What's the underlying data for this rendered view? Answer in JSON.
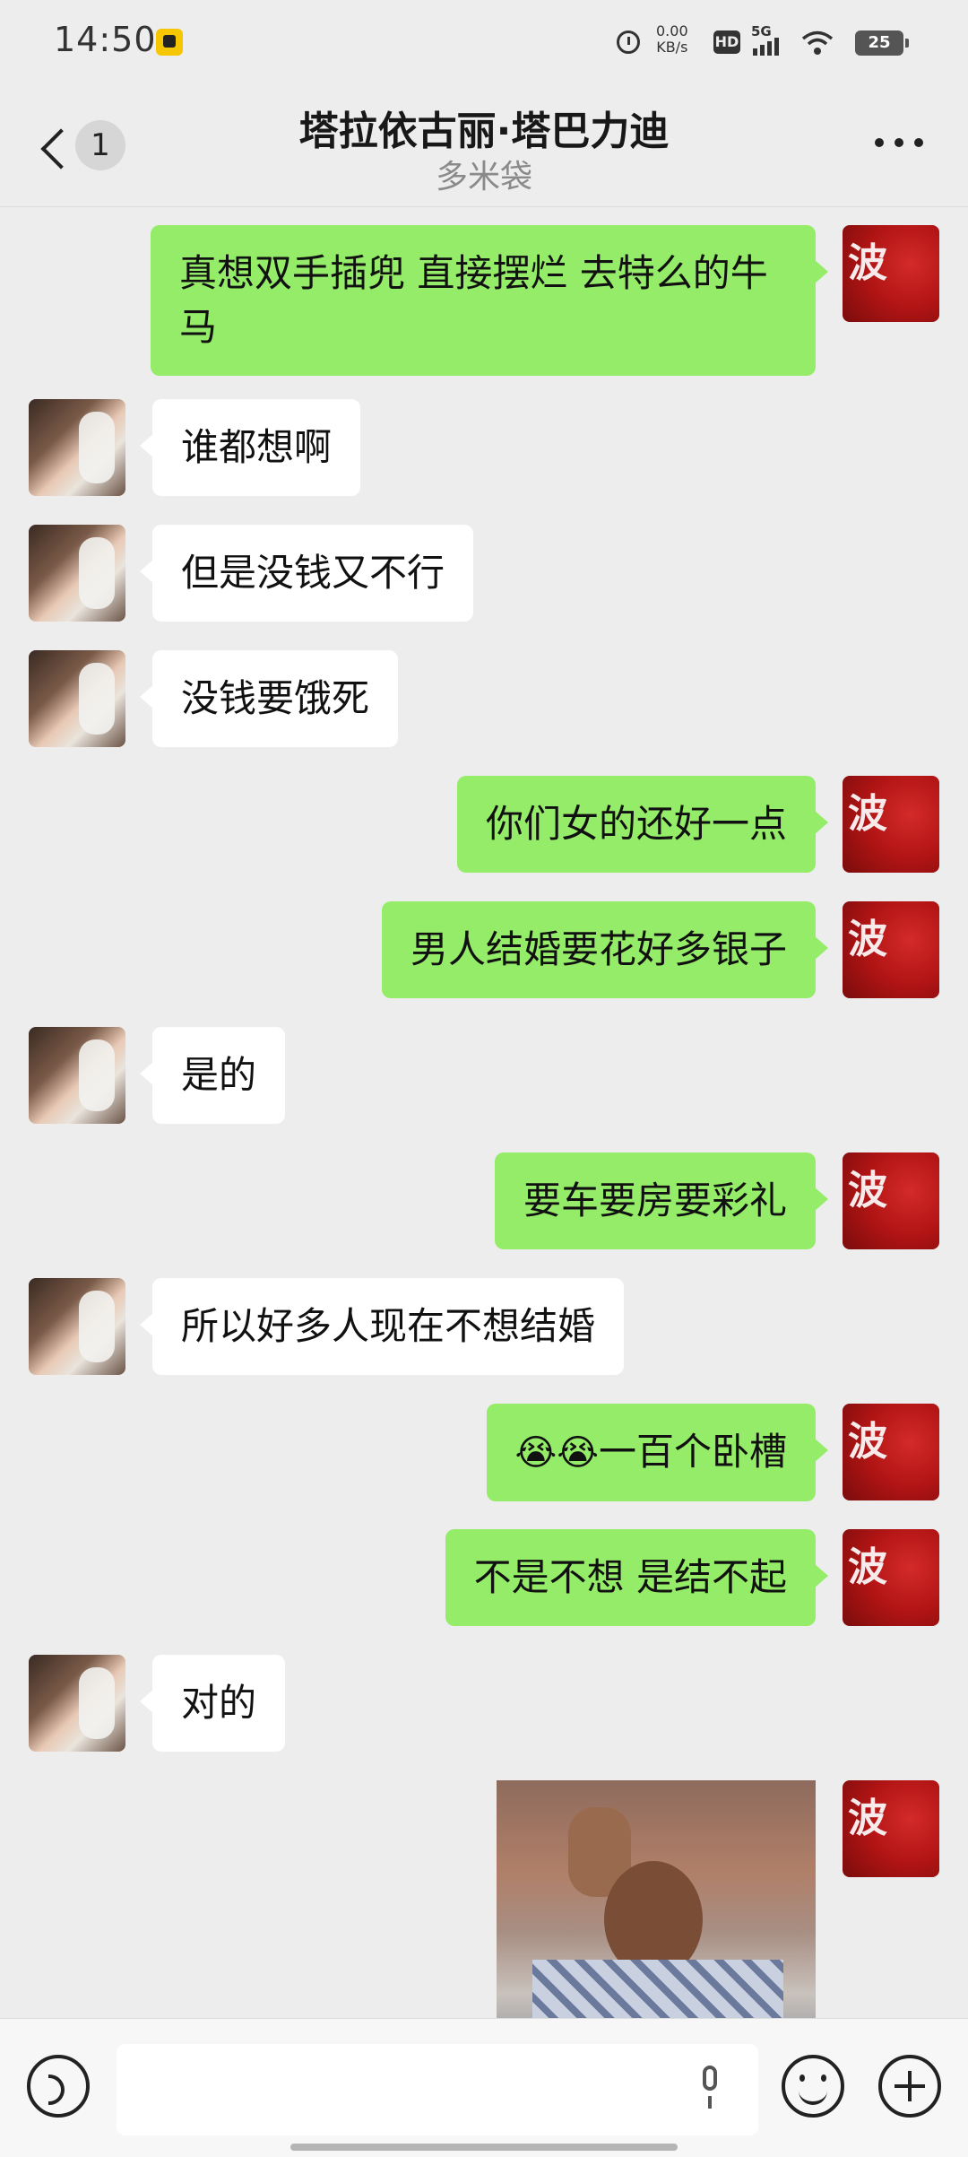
{
  "status_bar": {
    "time": "14:50",
    "net_speed": "0.00",
    "net_unit": "KB/s",
    "hd": "HD",
    "signal": "5G",
    "battery": "25"
  },
  "header": {
    "back_badge": "1",
    "title": "塔拉依古丽·塔巴力迪",
    "subtitle": "多米袋"
  },
  "messages": [
    {
      "side": "right",
      "text": "真想双手插兜 直接摆烂 去特么的牛马"
    },
    {
      "side": "left",
      "text": " 谁都想啊"
    },
    {
      "side": "left",
      "text": "但是没钱又不行"
    },
    {
      "side": "left",
      "text": "没钱要饿死"
    },
    {
      "side": "right",
      "text": "你们女的还好一点"
    },
    {
      "side": "right",
      "text": "男人结婚要花好多银子"
    },
    {
      "side": "left",
      "text": "是的"
    },
    {
      "side": "right",
      "text": "要车要房要彩礼"
    },
    {
      "side": "left",
      "text": "所以好多人现在不想结婚"
    },
    {
      "side": "right",
      "emojis": "😭😭",
      "text": "一百个卧槽"
    },
    {
      "side": "right",
      "text": "不是不想 是结不起"
    },
    {
      "side": "left",
      "text": "对的"
    },
    {
      "side": "right",
      "type": "sticker"
    }
  ],
  "avatars": {
    "self_glyph": "波"
  },
  "input": {
    "placeholder": ""
  }
}
